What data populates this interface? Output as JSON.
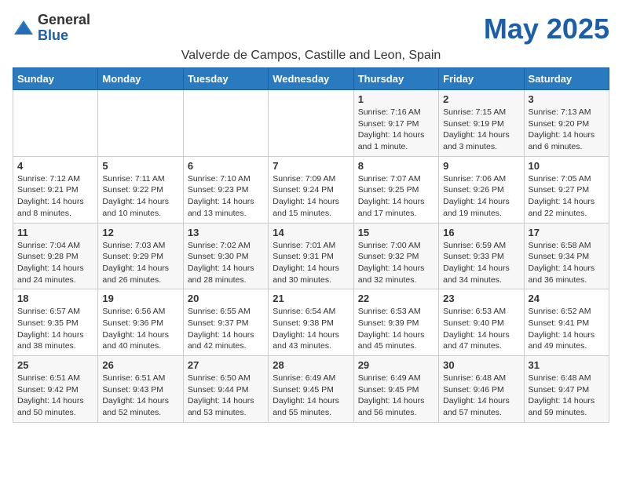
{
  "header": {
    "logo_general": "General",
    "logo_blue": "Blue",
    "month_title": "May 2025",
    "subtitle": "Valverde de Campos, Castille and Leon, Spain"
  },
  "days_of_week": [
    "Sunday",
    "Monday",
    "Tuesday",
    "Wednesday",
    "Thursday",
    "Friday",
    "Saturday"
  ],
  "weeks": [
    [
      {
        "day": "",
        "content": ""
      },
      {
        "day": "",
        "content": ""
      },
      {
        "day": "",
        "content": ""
      },
      {
        "day": "",
        "content": ""
      },
      {
        "day": "1",
        "content": "Sunrise: 7:16 AM\nSunset: 9:17 PM\nDaylight: 14 hours and 1 minute."
      },
      {
        "day": "2",
        "content": "Sunrise: 7:15 AM\nSunset: 9:19 PM\nDaylight: 14 hours and 3 minutes."
      },
      {
        "day": "3",
        "content": "Sunrise: 7:13 AM\nSunset: 9:20 PM\nDaylight: 14 hours and 6 minutes."
      }
    ],
    [
      {
        "day": "4",
        "content": "Sunrise: 7:12 AM\nSunset: 9:21 PM\nDaylight: 14 hours and 8 minutes."
      },
      {
        "day": "5",
        "content": "Sunrise: 7:11 AM\nSunset: 9:22 PM\nDaylight: 14 hours and 10 minutes."
      },
      {
        "day": "6",
        "content": "Sunrise: 7:10 AM\nSunset: 9:23 PM\nDaylight: 14 hours and 13 minutes."
      },
      {
        "day": "7",
        "content": "Sunrise: 7:09 AM\nSunset: 9:24 PM\nDaylight: 14 hours and 15 minutes."
      },
      {
        "day": "8",
        "content": "Sunrise: 7:07 AM\nSunset: 9:25 PM\nDaylight: 14 hours and 17 minutes."
      },
      {
        "day": "9",
        "content": "Sunrise: 7:06 AM\nSunset: 9:26 PM\nDaylight: 14 hours and 19 minutes."
      },
      {
        "day": "10",
        "content": "Sunrise: 7:05 AM\nSunset: 9:27 PM\nDaylight: 14 hours and 22 minutes."
      }
    ],
    [
      {
        "day": "11",
        "content": "Sunrise: 7:04 AM\nSunset: 9:28 PM\nDaylight: 14 hours and 24 minutes."
      },
      {
        "day": "12",
        "content": "Sunrise: 7:03 AM\nSunset: 9:29 PM\nDaylight: 14 hours and 26 minutes."
      },
      {
        "day": "13",
        "content": "Sunrise: 7:02 AM\nSunset: 9:30 PM\nDaylight: 14 hours and 28 minutes."
      },
      {
        "day": "14",
        "content": "Sunrise: 7:01 AM\nSunset: 9:31 PM\nDaylight: 14 hours and 30 minutes."
      },
      {
        "day": "15",
        "content": "Sunrise: 7:00 AM\nSunset: 9:32 PM\nDaylight: 14 hours and 32 minutes."
      },
      {
        "day": "16",
        "content": "Sunrise: 6:59 AM\nSunset: 9:33 PM\nDaylight: 14 hours and 34 minutes."
      },
      {
        "day": "17",
        "content": "Sunrise: 6:58 AM\nSunset: 9:34 PM\nDaylight: 14 hours and 36 minutes."
      }
    ],
    [
      {
        "day": "18",
        "content": "Sunrise: 6:57 AM\nSunset: 9:35 PM\nDaylight: 14 hours and 38 minutes."
      },
      {
        "day": "19",
        "content": "Sunrise: 6:56 AM\nSunset: 9:36 PM\nDaylight: 14 hours and 40 minutes."
      },
      {
        "day": "20",
        "content": "Sunrise: 6:55 AM\nSunset: 9:37 PM\nDaylight: 14 hours and 42 minutes."
      },
      {
        "day": "21",
        "content": "Sunrise: 6:54 AM\nSunset: 9:38 PM\nDaylight: 14 hours and 43 minutes."
      },
      {
        "day": "22",
        "content": "Sunrise: 6:53 AM\nSunset: 9:39 PM\nDaylight: 14 hours and 45 minutes."
      },
      {
        "day": "23",
        "content": "Sunrise: 6:53 AM\nSunset: 9:40 PM\nDaylight: 14 hours and 47 minutes."
      },
      {
        "day": "24",
        "content": "Sunrise: 6:52 AM\nSunset: 9:41 PM\nDaylight: 14 hours and 49 minutes."
      }
    ],
    [
      {
        "day": "25",
        "content": "Sunrise: 6:51 AM\nSunset: 9:42 PM\nDaylight: 14 hours and 50 minutes."
      },
      {
        "day": "26",
        "content": "Sunrise: 6:51 AM\nSunset: 9:43 PM\nDaylight: 14 hours and 52 minutes."
      },
      {
        "day": "27",
        "content": "Sunrise: 6:50 AM\nSunset: 9:44 PM\nDaylight: 14 hours and 53 minutes."
      },
      {
        "day": "28",
        "content": "Sunrise: 6:49 AM\nSunset: 9:45 PM\nDaylight: 14 hours and 55 minutes."
      },
      {
        "day": "29",
        "content": "Sunrise: 6:49 AM\nSunset: 9:45 PM\nDaylight: 14 hours and 56 minutes."
      },
      {
        "day": "30",
        "content": "Sunrise: 6:48 AM\nSunset: 9:46 PM\nDaylight: 14 hours and 57 minutes."
      },
      {
        "day": "31",
        "content": "Sunrise: 6:48 AM\nSunset: 9:47 PM\nDaylight: 14 hours and 59 minutes."
      }
    ]
  ]
}
